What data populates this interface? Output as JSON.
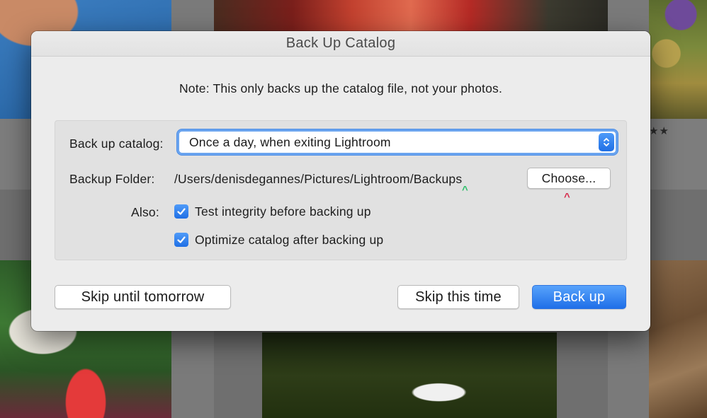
{
  "dialog": {
    "title": "Back Up Catalog",
    "note": "Note: This only backs up the catalog file, not your photos."
  },
  "backup_catalog": {
    "label": "Back up catalog:",
    "selected": "Once a day, when exiting Lightroom"
  },
  "backup_folder": {
    "label": "Backup Folder:",
    "path": "/Users/denisdegannes/Pictures/Lightroom/Backups",
    "choose_label": "Choose..."
  },
  "also": {
    "label": "Also:",
    "options": [
      {
        "label": "Test integrity before backing up",
        "checked": true
      },
      {
        "label": "Optimize catalog after backing up",
        "checked": true
      }
    ]
  },
  "buttons": {
    "skip_until_tomorrow": "Skip until tomorrow",
    "skip_this_time": "Skip this time",
    "back_up": "Back up"
  },
  "annotations": {
    "caret": "^"
  },
  "background": {
    "rating_stars": "★★"
  },
  "colors": {
    "accent": "#1f6fe5",
    "annotation_green": "#2fbf6a",
    "annotation_red": "#d62b4c"
  }
}
